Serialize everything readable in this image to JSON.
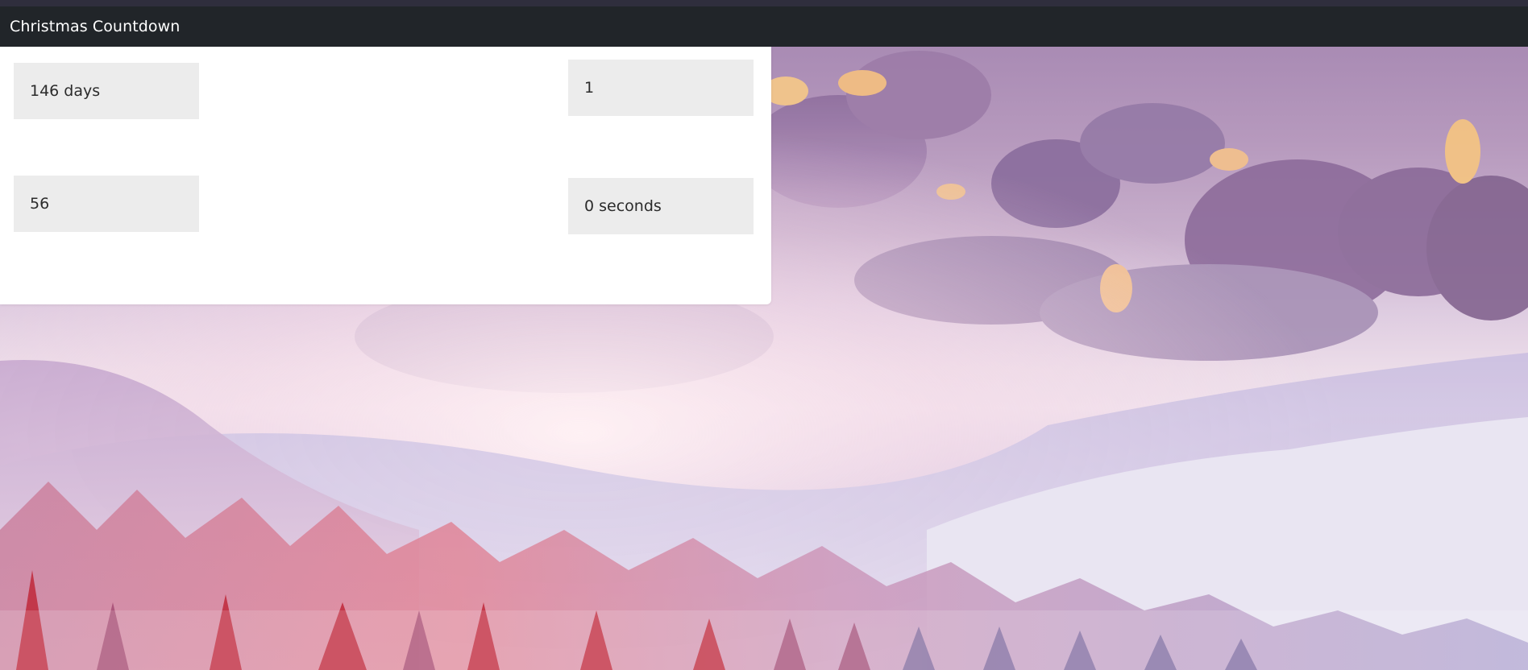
{
  "navbar": {
    "brand": "Christmas Countdown"
  },
  "countdown": {
    "days": "146 days",
    "hours": "1",
    "minutes": "56",
    "seconds": "0 seconds"
  },
  "background": {
    "description_icon": "winter-mountain-landscape",
    "sky_color": "#b699bd",
    "tree_accent_color": "#c0283a"
  }
}
